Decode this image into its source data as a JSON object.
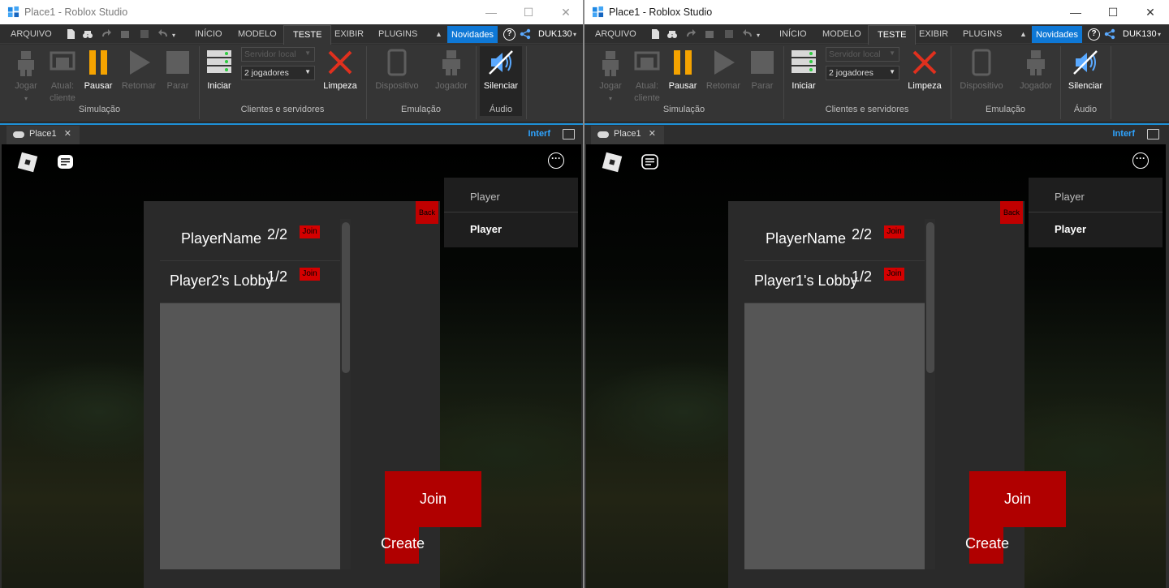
{
  "windows": [
    {
      "id": "left",
      "title": "Place1 - Roblox Studio",
      "lobbies": [
        {
          "name": "PlayerName",
          "count": "2/2",
          "join_label": "Join"
        },
        {
          "name": "Player2's Lobby",
          "count": "1/2",
          "join_label": "Join"
        }
      ]
    },
    {
      "id": "right",
      "title": "Place1 - Roblox Studio",
      "lobbies": [
        {
          "name": "PlayerName",
          "count": "2/2",
          "join_label": "Join"
        },
        {
          "name": "Player1's Lobby",
          "count": "1/2",
          "join_label": "Join"
        }
      ]
    }
  ],
  "menu": {
    "arquivo": "ARQUIVO",
    "tabs": [
      "INÍCIO",
      "MODELO",
      "TESTE",
      "EXIBIR",
      "PLUGINS"
    ],
    "active_tab": "TESTE",
    "novidades": "Novidades",
    "user": "DUK130"
  },
  "ribbon": {
    "jogar": "Jogar",
    "atual_cliente_1": "Atual:",
    "atual_cliente_2": "cliente",
    "pausar": "Pausar",
    "retomar": "Retomar",
    "parar": "Parar",
    "iniciar": "Iniciar",
    "servidor_local": "Servidor local",
    "jogadores": "2 jogadores",
    "limpeza": "Limpeza",
    "dispositivo": "Dispositivo",
    "jogador": "Jogador",
    "silenciar": "Silenciar",
    "groups": {
      "simulacao": "Simulação",
      "clientes": "Clientes e servidores",
      "emulacao": "Emulação",
      "audio": "Áudio"
    }
  },
  "doc": {
    "tab": "Place1",
    "close": "✕",
    "interf": "Interf"
  },
  "game": {
    "player_list": [
      "Player",
      "Player"
    ],
    "back_label": "Back",
    "join_label": "Join",
    "create_label": "Create",
    "more": "···"
  },
  "colors": {
    "accent_blue": "#0e78d6",
    "button_red": "#b00000",
    "pause_yellow": "#f5a300",
    "cleanup_red": "#e0301e"
  }
}
